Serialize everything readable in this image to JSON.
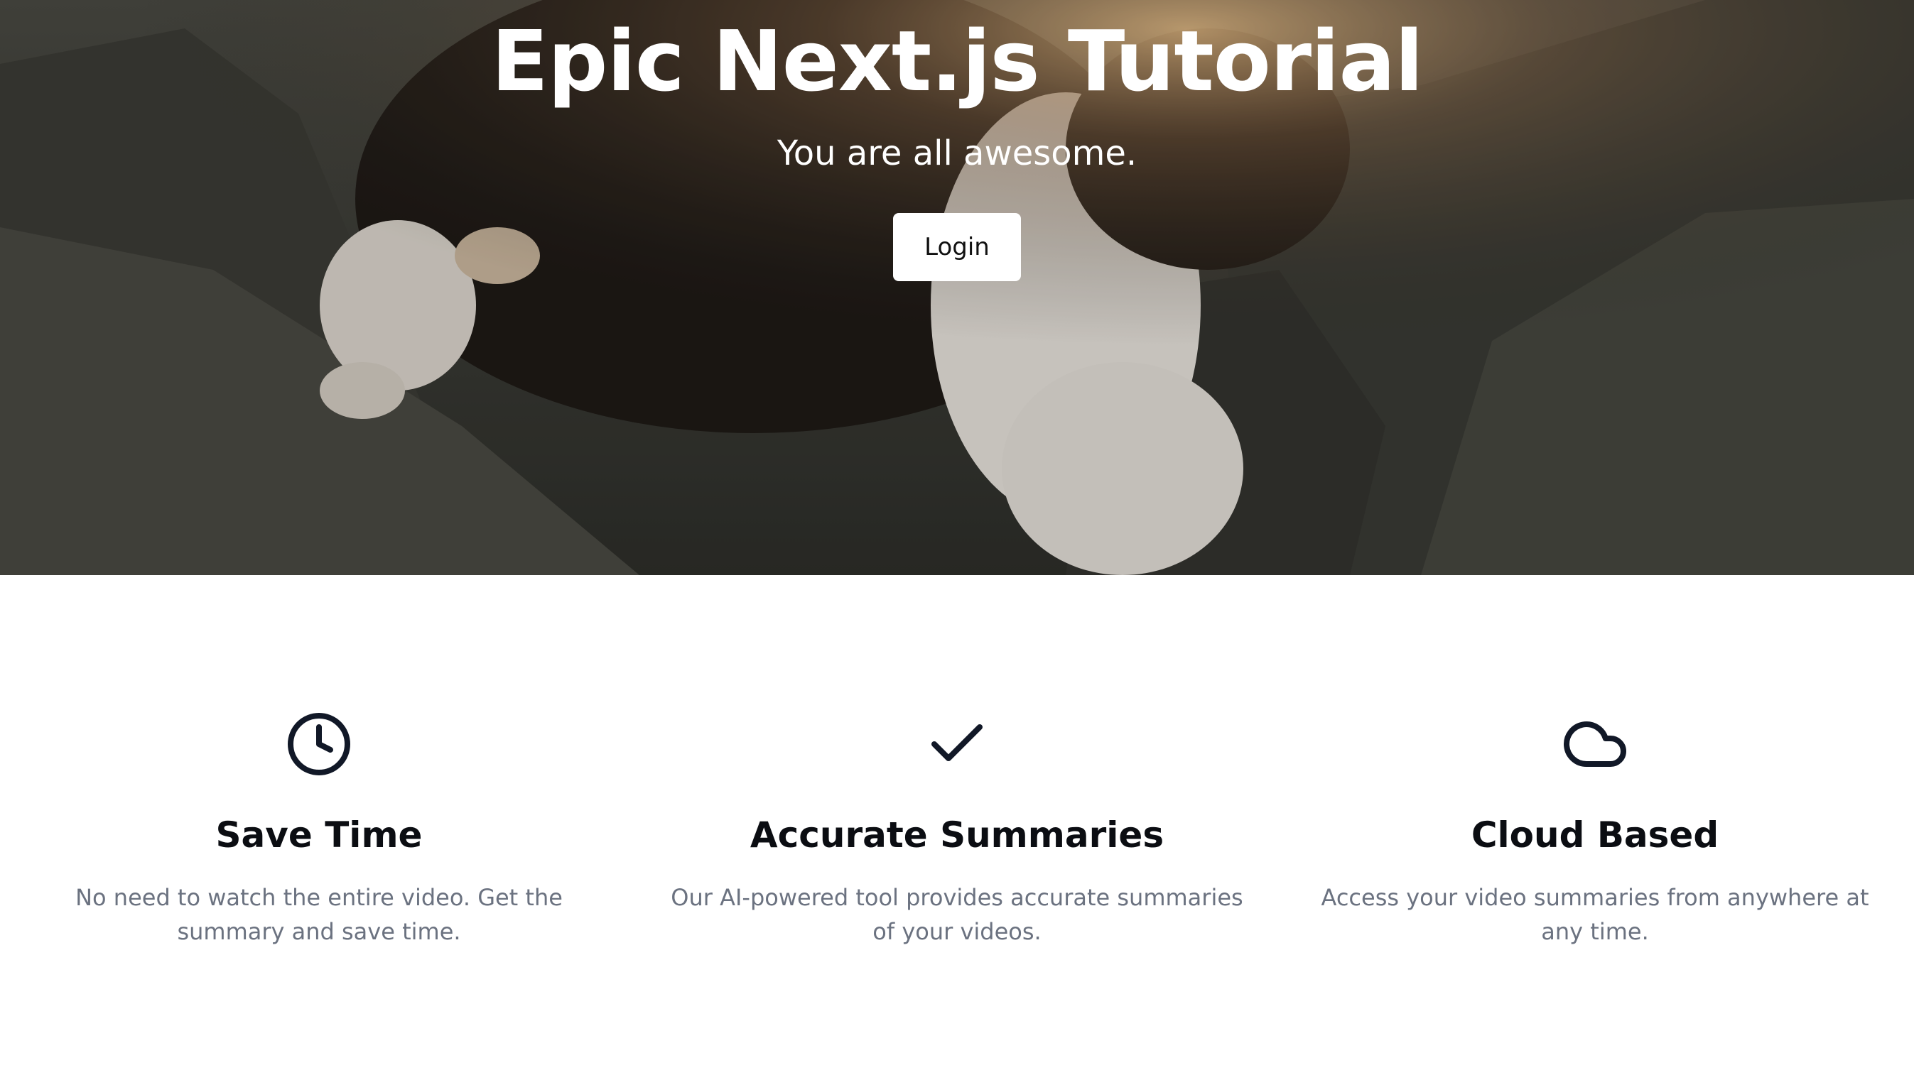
{
  "hero": {
    "title": "Epic Next.js Tutorial",
    "subtitle": "You are all awesome.",
    "login_label": "Login",
    "background_image": "cat-on-rocks-photo"
  },
  "features": [
    {
      "icon": "clock-icon",
      "title": "Save Time",
      "text": "No need to watch the entire video. Get the summary and save time."
    },
    {
      "icon": "check-icon",
      "title": "Accurate Summaries",
      "text": "Our AI-powered tool provides accurate summaries of your videos."
    },
    {
      "icon": "cloud-icon",
      "title": "Cloud Based",
      "text": "Access your video summaries from anywhere at any time."
    }
  ],
  "colors": {
    "hero_text": "#ffffff",
    "feature_title": "#0b0d12",
    "feature_text": "#6b7280",
    "icon_stroke": "#111827"
  }
}
